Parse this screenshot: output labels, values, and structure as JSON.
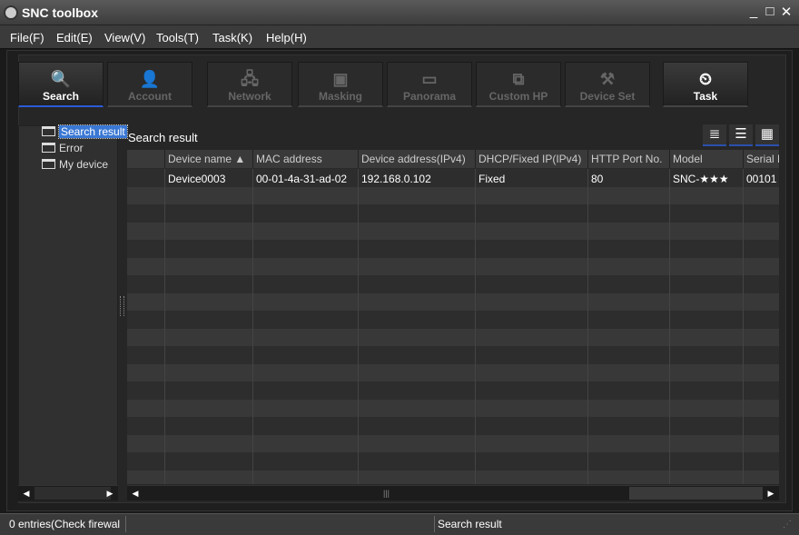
{
  "window": {
    "title": "SNC toolbox",
    "minimize": "_",
    "maximize": "□",
    "close": "✕"
  },
  "menu": [
    "File(F)",
    "Edit(E)",
    "View(V)",
    "Tools(T)",
    "Task(K)",
    "Help(H)"
  ],
  "toolbar": [
    {
      "label": "Search",
      "icon": "search-icon",
      "glyph": "🔍",
      "active": true
    },
    {
      "label": "Account",
      "icon": "user-icon",
      "glyph": "👤",
      "active": false
    },
    {
      "label": "Network",
      "icon": "network-icon",
      "glyph": "🖧",
      "active": false
    },
    {
      "label": "Masking",
      "icon": "masking-icon",
      "glyph": "▣",
      "active": false
    },
    {
      "label": "Panorama",
      "icon": "panorama-icon",
      "glyph": "▭",
      "active": false
    },
    {
      "label": "Custom HP",
      "icon": "custom-hp-icon",
      "glyph": "⧉",
      "active": false
    },
    {
      "label": "Device Set",
      "icon": "device-set-icon",
      "glyph": "⚒",
      "active": false
    },
    {
      "label": "Task",
      "icon": "task-icon",
      "glyph": "⏲",
      "active": true
    }
  ],
  "tree": [
    "Search result",
    "Error",
    "My device"
  ],
  "main": {
    "title": "Search result",
    "view_icons": [
      "≣",
      "☰",
      "▦"
    ]
  },
  "table": {
    "columns": [
      "",
      "Device name  ▲",
      "MAC address",
      "Device address(IPv4)",
      "DHCP/Fixed IP(IPv4)",
      "HTTP Port No.",
      "Model",
      "Serial No."
    ],
    "rows": [
      [
        "",
        "Device0003",
        "00-01-4a-31-ad-02",
        "192.168.0.102",
        "Fixed",
        "80",
        "SNC-★★★",
        "00101"
      ]
    ]
  },
  "status": {
    "left": "0 entries(Check firewal",
    "center": "Search result"
  },
  "colors": {
    "accent": "#2a5bd7",
    "selection": "#3a78d4"
  }
}
